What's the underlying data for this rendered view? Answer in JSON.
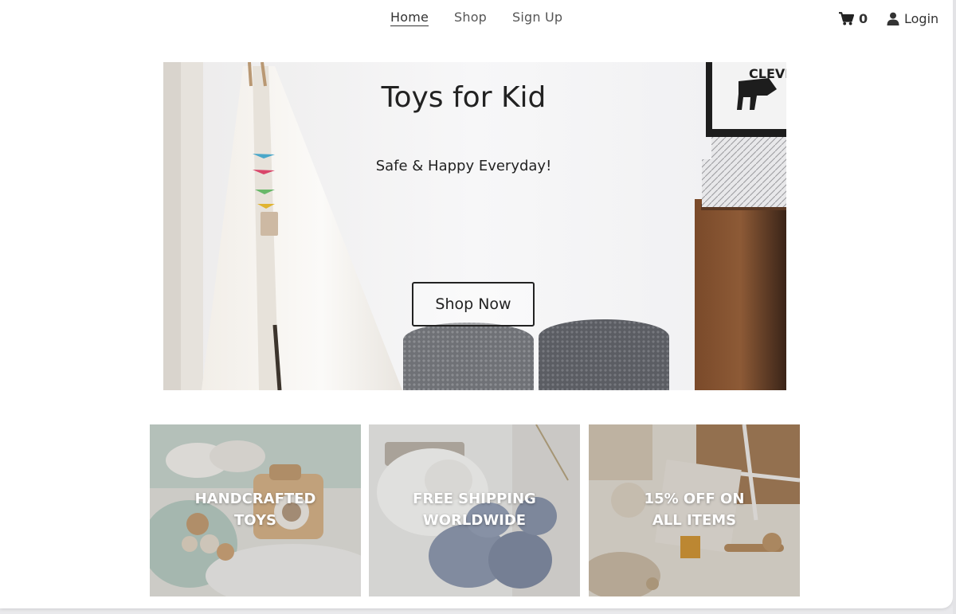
{
  "nav": {
    "links": [
      {
        "label": "Home",
        "active": true
      },
      {
        "label": "Shop",
        "active": false
      },
      {
        "label": "Sign Up",
        "active": false
      }
    ],
    "cart_icon": "shopping-cart-icon",
    "cart_count": "0",
    "login_icon": "user-icon",
    "login_label": "Login"
  },
  "hero": {
    "title": "Toys for Kid",
    "subtitle": "Safe & Happy Everyday!",
    "cta_label": "Shop Now",
    "poster_text": "CLEVER"
  },
  "tiles": [
    {
      "line1": "HANDCRAFTED",
      "line2": "TOYS"
    },
    {
      "line1": "FREE SHIPPING",
      "line2": "WORLDWIDE"
    },
    {
      "line1": "15% OFF ON",
      "line2": "ALL ITEMS"
    }
  ],
  "colors": {
    "text_dark": "#222222",
    "nav_text": "#555555",
    "tile_text": "#ffffff"
  }
}
